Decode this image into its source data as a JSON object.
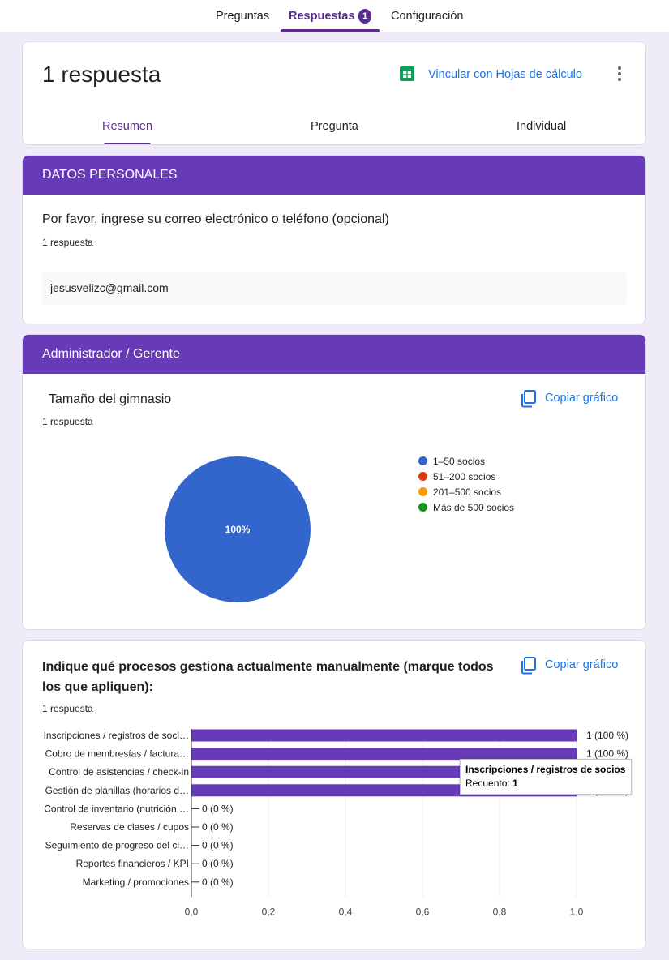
{
  "topnav": {
    "tabs": [
      "Preguntas",
      "Respuestas",
      "Configuración"
    ],
    "badge": "1"
  },
  "summary": {
    "title": "1 respuesta",
    "sheets_link": "Vincular con Hojas de cálculo",
    "subtabs": [
      "Resumen",
      "Pregunta",
      "Individual"
    ]
  },
  "section1": {
    "header": "DATOS PERSONALES",
    "question": "Por favor, ingrese su correo electrónico o teléfono (opcional)",
    "count": "1 respuesta",
    "answer": "jesusvelizc@gmail.com"
  },
  "section2": {
    "header": "Administrador / Gerente",
    "question": "Tamaño del gimnasio",
    "count": "1 respuesta",
    "copy_label": "Copiar gráfico",
    "pie_label": "100%"
  },
  "section3": {
    "question": "Indique qué procesos gestiona actualmente manualmente (marque todos los que apliquen):",
    "count": "1 respuesta",
    "copy_label": "Copiar gráfico",
    "tooltip": {
      "title": "Inscripciones / registros de socios",
      "count_label": "Recuento:",
      "count_value": "1"
    }
  },
  "colors": {
    "accent": "#673ab7",
    "bar": "#673ab7",
    "link": "#1a73e8"
  },
  "chart_data": [
    {
      "type": "pie",
      "categories": [
        "1–50 socios",
        "51–200 socios",
        "201–500 socios",
        "Más de 500 socios"
      ],
      "values": [
        1,
        0,
        0,
        0
      ],
      "colors": [
        "#3366cc",
        "#dc3912",
        "#ff9900",
        "#109618"
      ],
      "legend": "right"
    },
    {
      "type": "bar",
      "orientation": "horizontal",
      "categories": [
        "Inscripciones / registros de soci…",
        "Cobro de membresías / factura…",
        "Control de asistencias / check-in",
        "Gestión de planillas (horarios d…",
        "Control de inventario (nutrición,…",
        "Reservas de clases / cupos",
        "Seguimiento de progreso del cl…",
        "Reportes financieros / KPI",
        "Marketing / promociones"
      ],
      "values": [
        1,
        1,
        1,
        1,
        0,
        0,
        0,
        0,
        0
      ],
      "value_labels": [
        "1 (100 %)",
        "1 (100 %)",
        "1 (100 %)",
        "1 (100 %)",
        "0 (0 %)",
        "0 (0 %)",
        "0 (0 %)",
        "0 (0 %)",
        "0 (0 %)"
      ],
      "xlim": [
        0,
        1
      ],
      "xticks": [
        "0,0",
        "0,2",
        "0,4",
        "0,6",
        "0,8",
        "1,0"
      ],
      "grid": true
    }
  ]
}
